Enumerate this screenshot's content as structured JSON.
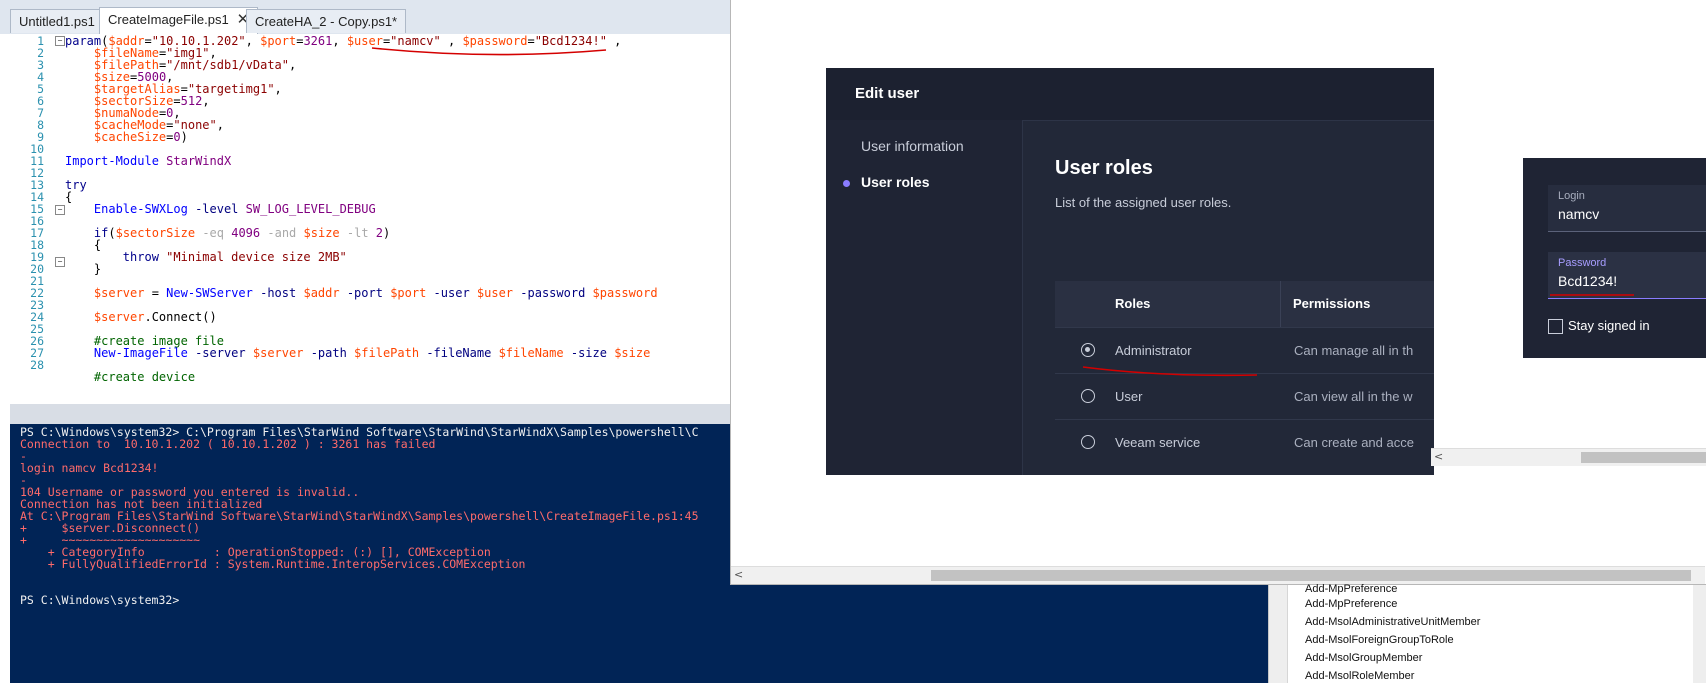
{
  "ise": {
    "tabs": [
      {
        "label": "Untitled1.ps1"
      },
      {
        "label": "CreateImageFile.ps1",
        "active": true,
        "close": "✕"
      },
      {
        "label": "CreateHA_2 - Copy.ps1*"
      }
    ],
    "line_numbers": [
      "1",
      "2",
      "3",
      "4",
      "5",
      "6",
      "7",
      "8",
      "9",
      "10",
      "11",
      "12",
      "13",
      "14",
      "15",
      "16",
      "17",
      "18",
      "19",
      "20",
      "21",
      "22",
      "23",
      "24",
      "25",
      "26",
      "27",
      "28"
    ]
  },
  "console": {
    "lines": [
      {
        "text": "PS C:\\Windows\\system32> C:\\Program Files\\StarWind Software\\StarWind\\StarWindX\\Samples\\powershell\\C",
        "color": "white"
      },
      {
        "text": "Connection to  10.10.1.202 ( 10.10.1.202 ) : 3261 has failed",
        "color": "red"
      },
      {
        "text": "-",
        "color": "red"
      },
      {
        "text": "login namcv Bcd1234!",
        "color": "red"
      },
      {
        "text": "-",
        "color": "red"
      },
      {
        "text": "104 Username or password you entered is invalid..",
        "color": "red"
      },
      {
        "text": "Connection has not been initialized",
        "color": "red"
      },
      {
        "text": "At C:\\Program Files\\StarWind Software\\StarWind\\StarWindX\\Samples\\powershell\\CreateImageFile.ps1:45",
        "color": "red"
      },
      {
        "text": "+     $server.Disconnect()",
        "color": "red"
      },
      {
        "text": "+     ~~~~~~~~~~~~~~~~~~~~",
        "color": "red"
      },
      {
        "text": "    + CategoryInfo          : OperationStopped: (:) [], COMException",
        "color": "red"
      },
      {
        "text": "    + FullyQualifiedErrorId : System.Runtime.InteropServices.COMException",
        "color": "red"
      },
      {
        "text": "",
        "color": "white"
      },
      {
        "text": "",
        "color": "white"
      },
      {
        "text": "PS C:\\Windows\\system32>",
        "color": "white"
      }
    ]
  },
  "dialog": {
    "title": "Edit user",
    "sidebar": [
      {
        "label": "User information"
      },
      {
        "label": "User roles",
        "active": true
      }
    ],
    "section_title": "User roles",
    "section_desc": "List of the assigned user roles.",
    "columns": {
      "roles": "Roles",
      "permissions": "Permissions"
    },
    "rows": [
      {
        "role": "Administrator",
        "permission": "Can manage all in th",
        "selected": true
      },
      {
        "role": "User",
        "permission": "Can view all in the w",
        "selected": false
      },
      {
        "role": "Veeam service",
        "permission": "Can create and acce",
        "selected": false
      }
    ]
  },
  "login": {
    "login_label": "Login",
    "login_value": "namcv",
    "password_label": "Password",
    "password_value": "Bcd1234!",
    "stay_signed_in": "Stay signed in"
  },
  "commands": [
    "Add-MpPreference",
    "Add-MpPreference",
    "Add-MsolAdministrativeUnitMember",
    "Add-MsolForeignGroupToRole",
    "Add-MsolGroupMember",
    "Add-MsolRoleMember"
  ],
  "colors": {
    "annotation": "#d40000",
    "accent": "#8a7cff",
    "console_bg": "#012456"
  }
}
